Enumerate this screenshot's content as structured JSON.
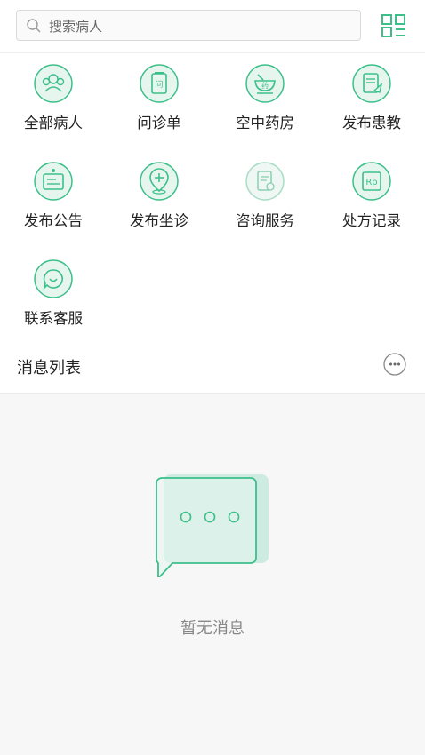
{
  "search": {
    "placeholder": "搜索病人"
  },
  "grid": [
    {
      "label": "全部病人",
      "icon": "patients-icon"
    },
    {
      "label": "问诊单",
      "icon": "consult-form-icon"
    },
    {
      "label": "空中药房",
      "icon": "pharmacy-icon"
    },
    {
      "label": "发布患教",
      "icon": "education-icon"
    },
    {
      "label": "发布公告",
      "icon": "announcement-icon"
    },
    {
      "label": "发布坐诊",
      "icon": "clinic-location-icon"
    },
    {
      "label": "咨询服务",
      "icon": "consult-service-icon"
    },
    {
      "label": "处方记录",
      "icon": "prescription-icon"
    },
    {
      "label": "联系客服",
      "icon": "customer-service-icon"
    }
  ],
  "messages": {
    "title": "消息列表",
    "empty_text": "暂无消息"
  },
  "colors": {
    "accent": "#3dbf8a",
    "icon_bg": "#e6f6ef"
  }
}
